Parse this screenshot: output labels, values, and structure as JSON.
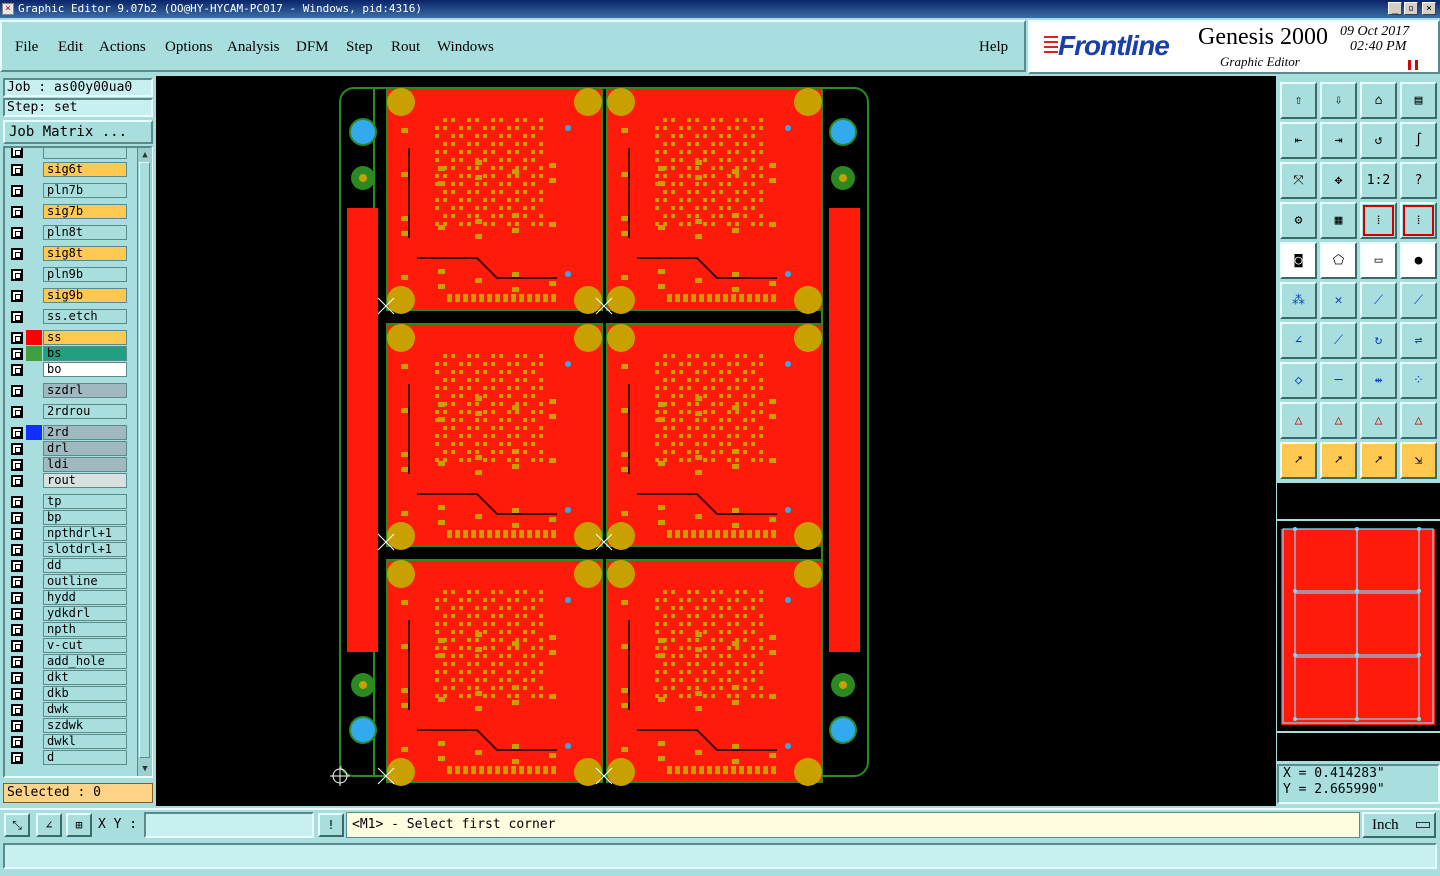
{
  "window": {
    "title": "Graphic Editor 9.07b2 (OO@HY-HYCAM-PC017 - Windows, pid:4316)"
  },
  "menu": [
    "File",
    "Edit",
    "Actions",
    "Options",
    "Analysis",
    "DFM",
    "Step",
    "Rout",
    "Windows"
  ],
  "help_label": "Help",
  "brand": {
    "logo": "Frontline",
    "product": "Genesis 2000",
    "subtitle": "Graphic Editor",
    "date": "09 Oct 2017",
    "time": "02:40 PM"
  },
  "job": {
    "job_text": "Job : as00y00ua0",
    "step_text": "Step: set",
    "matrix_label": "Job Matrix ..."
  },
  "layers": [
    {
      "name": "sig6t",
      "color": "#ffc850",
      "swatch": ""
    },
    {
      "name": "pln7b",
      "color": "#a8dede",
      "swatch": ""
    },
    {
      "name": "sig7b",
      "color": "#ffc850",
      "swatch": ""
    },
    {
      "name": "pln8t",
      "color": "#a8dede",
      "swatch": ""
    },
    {
      "name": "sig8t",
      "color": "#ffc850",
      "swatch": ""
    },
    {
      "name": "pln9b",
      "color": "#a8dede",
      "swatch": ""
    },
    {
      "name": "sig9b",
      "color": "#ffc850",
      "swatch": ""
    },
    {
      "name": "ss.etch",
      "color": "#a8dede",
      "swatch": ""
    },
    {
      "name": "ss",
      "color": "#ffc850",
      "swatch": "#ff0000"
    },
    {
      "name": "bs",
      "color": "#20a080",
      "swatch": "#40a040"
    },
    {
      "name": "bo",
      "color": "#ffffff",
      "swatch": ""
    },
    {
      "name": "szdrl",
      "color": "#a0b8c0",
      "swatch": ""
    },
    {
      "name": "2rdrou",
      "color": "#a8dede",
      "swatch": ""
    },
    {
      "name": "2rd",
      "color": "#a0b8c0",
      "swatch": "#1030ff"
    },
    {
      "name": "drl",
      "color": "#a0b8c0",
      "swatch": ""
    },
    {
      "name": "ldi",
      "color": "#a0b8c0",
      "swatch": ""
    },
    {
      "name": "rout",
      "color": "#d8e0e0",
      "swatch": ""
    },
    {
      "name": "tp",
      "color": "#a8dede",
      "swatch": ""
    },
    {
      "name": "bp",
      "color": "#a8dede",
      "swatch": ""
    },
    {
      "name": "npthdrl+1",
      "color": "#a8dede",
      "swatch": ""
    },
    {
      "name": "slotdrl+1",
      "color": "#a8dede",
      "swatch": ""
    },
    {
      "name": "dd",
      "color": "#a8dede",
      "swatch": ""
    },
    {
      "name": "outline",
      "color": "#a8dede",
      "swatch": ""
    },
    {
      "name": "hydd",
      "color": "#a8dede",
      "swatch": ""
    },
    {
      "name": "ydkdrl",
      "color": "#a8dede",
      "swatch": ""
    },
    {
      "name": "npth",
      "color": "#a8dede",
      "swatch": ""
    },
    {
      "name": "v-cut",
      "color": "#a8dede",
      "swatch": ""
    },
    {
      "name": "add_hole",
      "color": "#a8dede",
      "swatch": ""
    },
    {
      "name": "dkt",
      "color": "#a8dede",
      "swatch": ""
    },
    {
      "name": "dkb",
      "color": "#a8dede",
      "swatch": ""
    },
    {
      "name": "dwk",
      "color": "#a8dede",
      "swatch": ""
    },
    {
      "name": "szdwk",
      "color": "#a8dede",
      "swatch": ""
    },
    {
      "name": "dwkl",
      "color": "#a8dede",
      "swatch": ""
    },
    {
      "name": "d",
      "color": "#a8dede",
      "swatch": ""
    }
  ],
  "selected_text": "Selected : 0",
  "coords": {
    "x_text": "X = 0.414283\"",
    "y_text": "Y = 2.665990\""
  },
  "toolbar": {
    "row_labels": [
      "1:2",
      "?"
    ]
  },
  "bottom": {
    "xy_label": "X Y :",
    "xy_value": "",
    "prompt": "<M1> - Select first corner",
    "unit": "Inch"
  },
  "colors": {
    "board": "#ff1a0a",
    "pad": "#c8a000",
    "outline": "#2a8a20",
    "background": "#000000"
  }
}
